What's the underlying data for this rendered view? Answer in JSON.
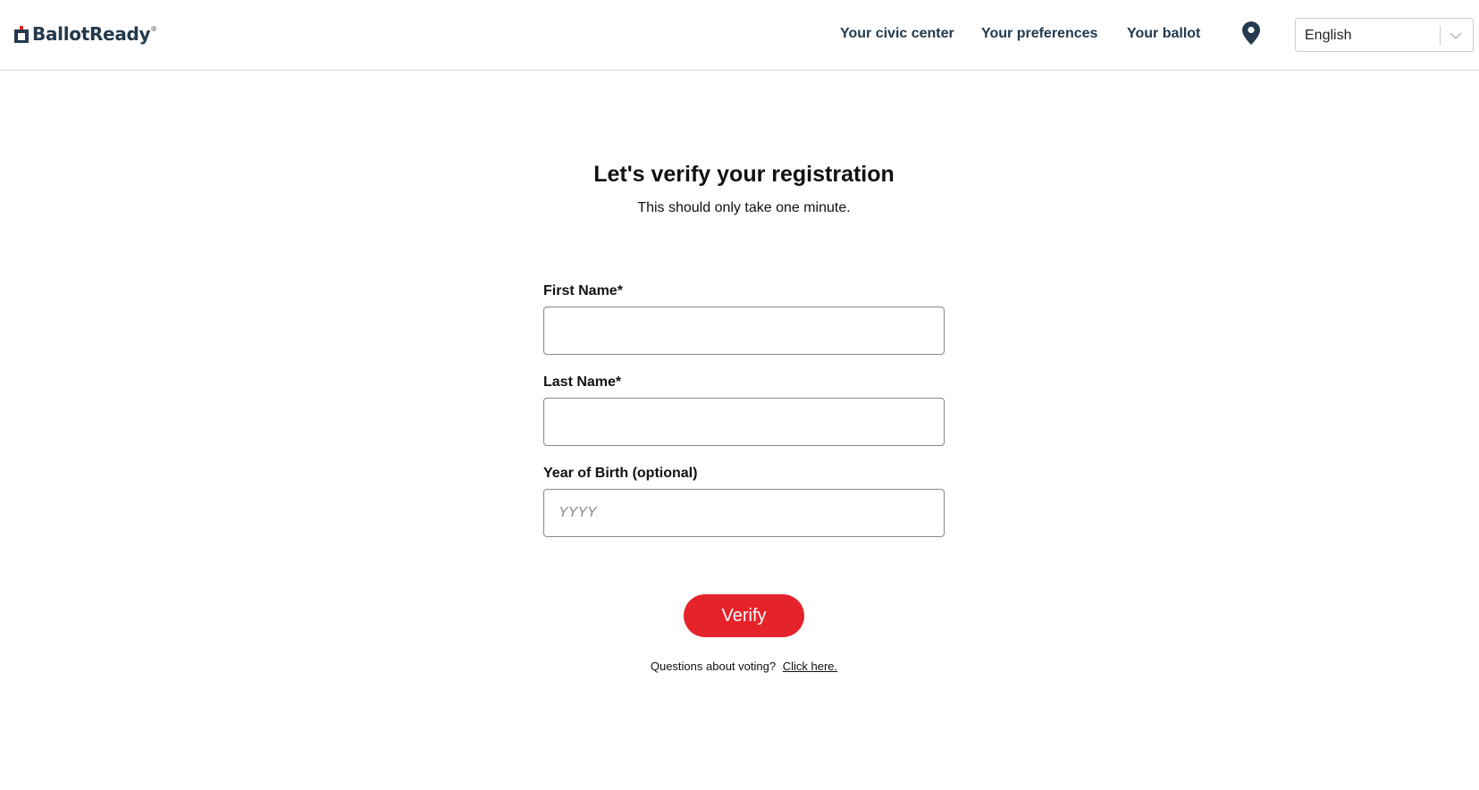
{
  "brand": {
    "name": "BallotReady",
    "registered_mark": "®",
    "color": "#23394d"
  },
  "nav": {
    "items": [
      {
        "label": "Your civic center"
      },
      {
        "label": "Your preferences"
      },
      {
        "label": "Your ballot"
      }
    ],
    "location_icon": "map-pin-icon"
  },
  "language": {
    "selected": "English",
    "icon": "chevron-down-icon"
  },
  "main": {
    "title": "Let's verify your registration",
    "subtitle": "This should only take one minute."
  },
  "form": {
    "first_name": {
      "label": "First Name*",
      "value": "",
      "placeholder": ""
    },
    "last_name": {
      "label": "Last Name*",
      "value": "",
      "placeholder": ""
    },
    "year_of_birth": {
      "label": "Year of Birth (optional)",
      "value": "",
      "placeholder": "YYYY"
    },
    "submit_label": "Verify",
    "submit_color": "#e4232a"
  },
  "help": {
    "question": "Questions about voting?",
    "link_label": "Click here."
  }
}
